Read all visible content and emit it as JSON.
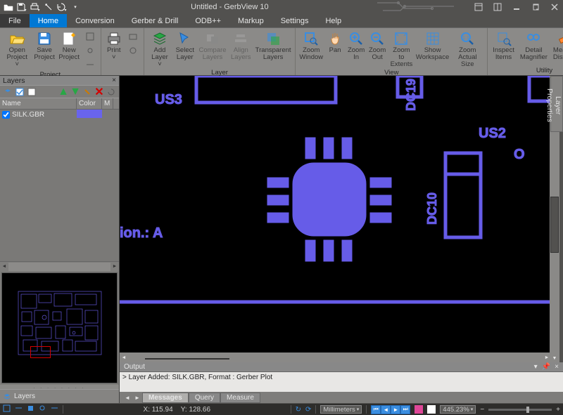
{
  "window": {
    "title": "Untitled - GerbView 10"
  },
  "menus": {
    "file": "File",
    "home": "Home",
    "conversion": "Conversion",
    "gerber": "Gerber & Drill",
    "odb": "ODB++",
    "markup": "Markup",
    "settings": "Settings",
    "help": "Help"
  },
  "ribbon": {
    "project": {
      "label": "Project",
      "open": "Open\nProject ˅",
      "save": "Save\nProject",
      "new": "New\nProject"
    },
    "print": {
      "label": "",
      "print": "Print\n˅"
    },
    "layer": {
      "label": "Layer",
      "add": "Add\nLayer ˅",
      "select": "Select\nLayer",
      "compare": "Compare\nLayers",
      "align": "Align\nLayers",
      "transparent": "Transparent\nLayers"
    },
    "view": {
      "label": "View",
      "zoomwin": "Zoom\nWindow",
      "pan": "Pan",
      "zoomin": "Zoom\nIn",
      "zoomout": "Zoom\nOut",
      "extents": "Zoom to\nExtents",
      "workspace": "Show\nWorkspace",
      "actual": "Zoom\nActual Size"
    },
    "utility": {
      "label": "Utility",
      "inspect": "Inspect\nItems",
      "magnifier": "Detail\nMagnifier",
      "measure": "Measure\nDistance"
    }
  },
  "layersPanel": {
    "title": "Layers",
    "cols": {
      "name": "Name",
      "color": "Color",
      "m": "M"
    },
    "items": [
      {
        "name": "SILK.GBR",
        "color": "#6964ec"
      }
    ],
    "footer": "Layers"
  },
  "canvas": {
    "labels": {
      "us3": "US3",
      "dc19": "DC19",
      "us2": "US2",
      "dc10": "DC10",
      "ion": "ion.: A",
      "o": "O"
    }
  },
  "proptab": "Layer Properties",
  "output": {
    "title": "Output",
    "line": "> Layer Added: SILK.GBR, Format : Gerber Plot",
    "tabs": {
      "messages": "Messages",
      "query": "Query",
      "measure": "Measure"
    }
  },
  "status": {
    "x_lbl": "X:",
    "x": "115.94",
    "y_lbl": "Y:",
    "y": "128.66",
    "units": "Millimeters",
    "zoom": "445.23%"
  }
}
